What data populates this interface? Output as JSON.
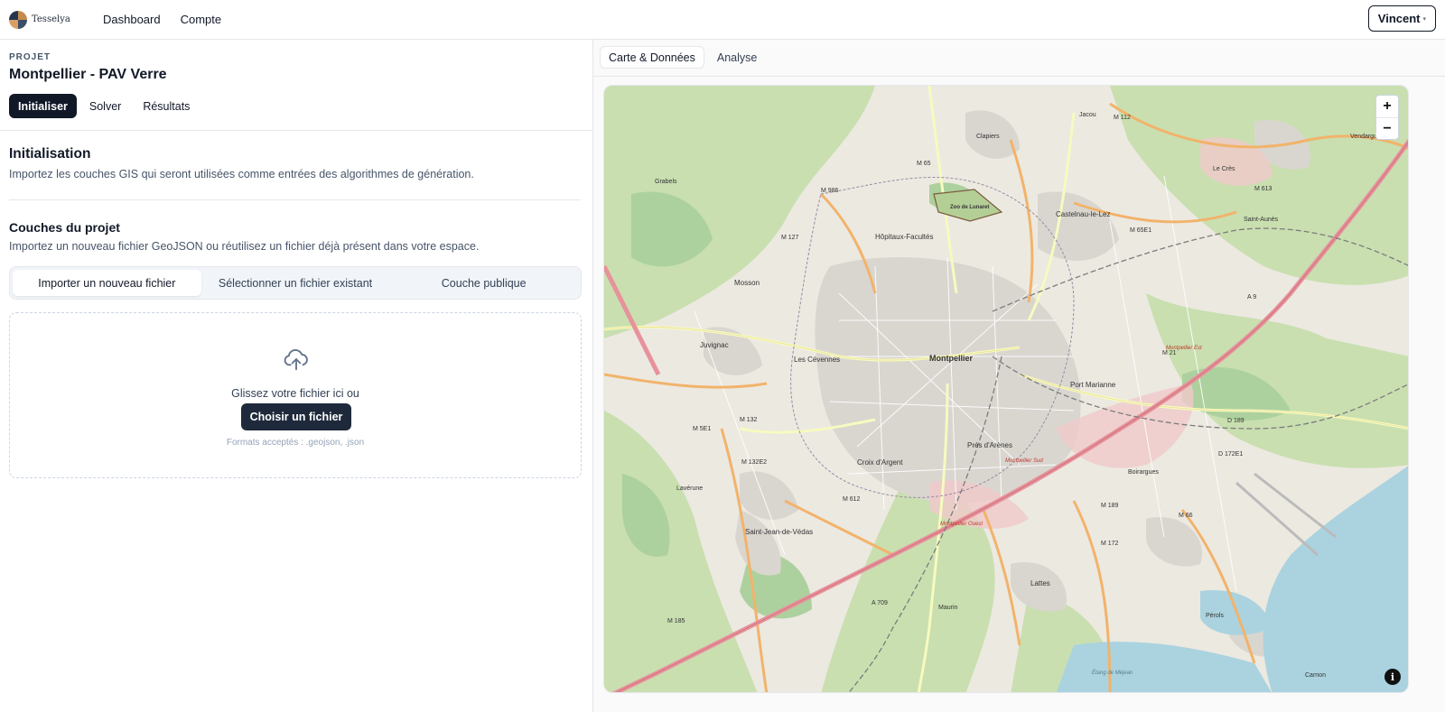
{
  "brand": {
    "name": "Tesselya"
  },
  "nav": {
    "dashboard": "Dashboard",
    "account": "Compte"
  },
  "user": {
    "name": "Vincent",
    "caret": "▾"
  },
  "project": {
    "label": "PROJET",
    "title": "Montpellier - PAV Verre",
    "steps": [
      "Initialiser",
      "Solver",
      "Résultats"
    ]
  },
  "init": {
    "heading": "Initialisation",
    "description": "Importez les couches GIS qui seront utilisées comme entrées des algorithmes de génération."
  },
  "layers": {
    "heading": "Couches du projet",
    "description": "Importez un nouveau fichier GeoJSON ou réutilisez un fichier déjà présent dans votre espace.",
    "tabs": [
      "Importer un nouveau fichier",
      "Sélectionner un fichier existant",
      "Couche publique"
    ]
  },
  "dropzone": {
    "text": "Glissez votre fichier ici ou",
    "button": "Choisir un fichier",
    "hint": "Formats acceptés : .geojson, .json"
  },
  "right_tabs": [
    "Carte & Données",
    "Analyse"
  ],
  "map": {
    "zoom_in": "+",
    "zoom_out": "−",
    "info": "i",
    "places": [
      "Montpellier",
      "Castelnau-le-Lez",
      "Hôpitaux-Facultés",
      "Les Cévennes",
      "Juvignac",
      "Mosson",
      "Port Marianne",
      "Prés d'Arènes",
      "Croix d'Argent",
      "Saint-Jean-de-Védas",
      "Lattes",
      "Pérols",
      "Boirargues",
      "Maurin",
      "Lavérune",
      "Clapiers",
      "Jacou",
      "Vendargues",
      "Le Crès",
      "Saint-Aunès",
      "Grabels",
      "Carnon",
      "Zoo de Lunaret",
      "Montpellier Est",
      "Montpellier Sud",
      "Montpellier Ouest",
      "Étang de Méjean"
    ],
    "roads": [
      "A 709",
      "A 9",
      "M 65",
      "M 986",
      "M 127",
      "M 132",
      "M 21",
      "M 112",
      "M 613",
      "M 65E1",
      "D 189",
      "D 172E1",
      "M 189",
      "M 172",
      "M 66",
      "M 132E2",
      "M 612",
      "M 5E1",
      "M 185"
    ]
  }
}
